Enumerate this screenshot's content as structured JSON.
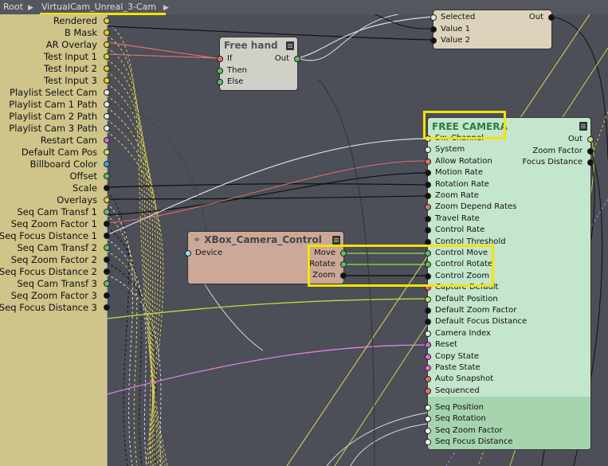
{
  "breadcrumb": {
    "root": "Root",
    "graph": "VirtualCam_Unreal_3-Cam"
  },
  "colors": {
    "highlight": "#f4e400",
    "left_panel": "#cfc48a",
    "free_camera": "#c4e6cc",
    "xbox_node": "#cba898",
    "free_hand": "#d0d0c8",
    "selector": "#ddd3bc"
  },
  "left_outputs": [
    {
      "label": "Rendered",
      "color": "#e0d030"
    },
    {
      "label": "B Mask",
      "color": "#e0d030"
    },
    {
      "label": "AR Overlay",
      "color": "#e0d030"
    },
    {
      "label": "Test Input 1",
      "color": "#e0d030"
    },
    {
      "label": "Test Input 2",
      "color": "#e0d030"
    },
    {
      "label": "Test Input 3",
      "color": "#e0d030"
    },
    {
      "label": "Playlist Select Cam",
      "color": "#e8e8e8"
    },
    {
      "label": "Playlist Cam 1 Path",
      "color": "#e8e8e8"
    },
    {
      "label": "Playlist Cam 2 Path",
      "color": "#e8e8e8"
    },
    {
      "label": "Playlist Cam 3 Path",
      "color": "#e8e8e8"
    },
    {
      "label": "Restart Cam",
      "color": "#c070d0"
    },
    {
      "label": "Default Cam Pos",
      "color": "#c8e070"
    },
    {
      "label": "Billboard Color",
      "color": "#40a0d0"
    },
    {
      "label": "Offset",
      "color": "#60c060"
    },
    {
      "label": "Scale",
      "color": "#111111"
    },
    {
      "label": "Overlays",
      "color": "#e0d030"
    },
    {
      "label": "Seq Cam Transf 1",
      "color": "#60c060"
    },
    {
      "label": "Seq Zoom Factor 1",
      "color": "#111111"
    },
    {
      "label": "Seq Focus Distance 1",
      "color": "#111111"
    },
    {
      "label": "Seq Cam Transf 2",
      "color": "#60c060"
    },
    {
      "label": "Seq Zoom Factor 2",
      "color": "#111111"
    },
    {
      "label": "Seq Focus Distance 2",
      "color": "#111111"
    },
    {
      "label": "Seq Cam Transf 3",
      "color": "#60c060"
    },
    {
      "label": "Seq Zoom Factor 3",
      "color": "#111111"
    },
    {
      "label": "Seq Focus Distance 3",
      "color": "#111111"
    }
  ],
  "selector_node": {
    "inputs": [
      {
        "label": "Selected",
        "color": "#e8e8e8"
      },
      {
        "label": "Value 1",
        "color": "#111111"
      },
      {
        "label": "Value 2",
        "color": "#111111"
      }
    ],
    "output": {
      "label": "Out",
      "color": "#111111"
    }
  },
  "free_hand_node": {
    "title": "Free hand",
    "inputs": [
      {
        "label": "If",
        "color": "#e07070"
      },
      {
        "label": "Then",
        "color": "#60c060"
      },
      {
        "label": "Else",
        "color": "#60c060"
      }
    ],
    "output": {
      "label": "Out",
      "color": "#60c060"
    }
  },
  "xbox_node": {
    "title": "XBox_Camera_Control",
    "inputs": [
      {
        "label": "Device",
        "color": "#a0e0e8"
      }
    ],
    "outputs": [
      {
        "label": "Move",
        "color": "#60c060"
      },
      {
        "label": "Rotate",
        "color": "#60c060"
      },
      {
        "label": "Zoom",
        "color": "#111111"
      }
    ]
  },
  "free_camera_node": {
    "title": "FREE CAMERA",
    "inputs": [
      {
        "label": "Sw. Channel",
        "color": "#e8e8e8"
      },
      {
        "label": "System",
        "color": "#e8e8e8"
      },
      {
        "label": "Allow Rotation",
        "color": "#e07070"
      },
      {
        "label": "Motion Rate",
        "color": "#111111"
      },
      {
        "label": "Rotation Rate",
        "color": "#111111"
      },
      {
        "label": "Zoom Rate",
        "color": "#111111"
      },
      {
        "label": "Zoom Depend Rates",
        "color": "#e07070"
      },
      {
        "label": "Travel Rate",
        "color": "#111111"
      },
      {
        "label": "Control Rate",
        "color": "#111111"
      },
      {
        "label": "Control Threshold",
        "color": "#111111"
      },
      {
        "label": "Control Move",
        "color": "#60c060"
      },
      {
        "label": "Control Rotate",
        "color": "#60c060"
      },
      {
        "label": "Control Zoom",
        "color": "#111111"
      },
      {
        "label": "Capture Default",
        "color": "#e07070"
      },
      {
        "label": "Default Position",
        "color": "#c8e070"
      },
      {
        "label": "Default Zoom Factor",
        "color": "#111111"
      },
      {
        "label": "Default Focus Distance",
        "color": "#111111"
      },
      {
        "label": "Camera Index",
        "color": "#e8e8e8"
      },
      {
        "label": "Reset",
        "color": "#c070d0"
      },
      {
        "label": "Copy State",
        "color": "#e070d0"
      },
      {
        "label": "Paste State",
        "color": "#e070d0"
      },
      {
        "label": "Auto Snapshot",
        "color": "#e07070"
      },
      {
        "label": "Sequenced",
        "color": "#e07070"
      }
    ],
    "seq_inputs": [
      {
        "label": "Seq Position",
        "color": "#ffffff"
      },
      {
        "label": "Seq Rotation",
        "color": "#ffffff"
      },
      {
        "label": "Seq Zoom Factor",
        "color": "#ffffff"
      },
      {
        "label": "Seq Focus Distance",
        "color": "#ffffff"
      }
    ],
    "outputs": [
      {
        "label": "Out",
        "color": "#c8e070"
      },
      {
        "label": "Zoom Factor",
        "color": "#111111"
      },
      {
        "label": "Focus Distance",
        "color": "#111111"
      }
    ]
  }
}
